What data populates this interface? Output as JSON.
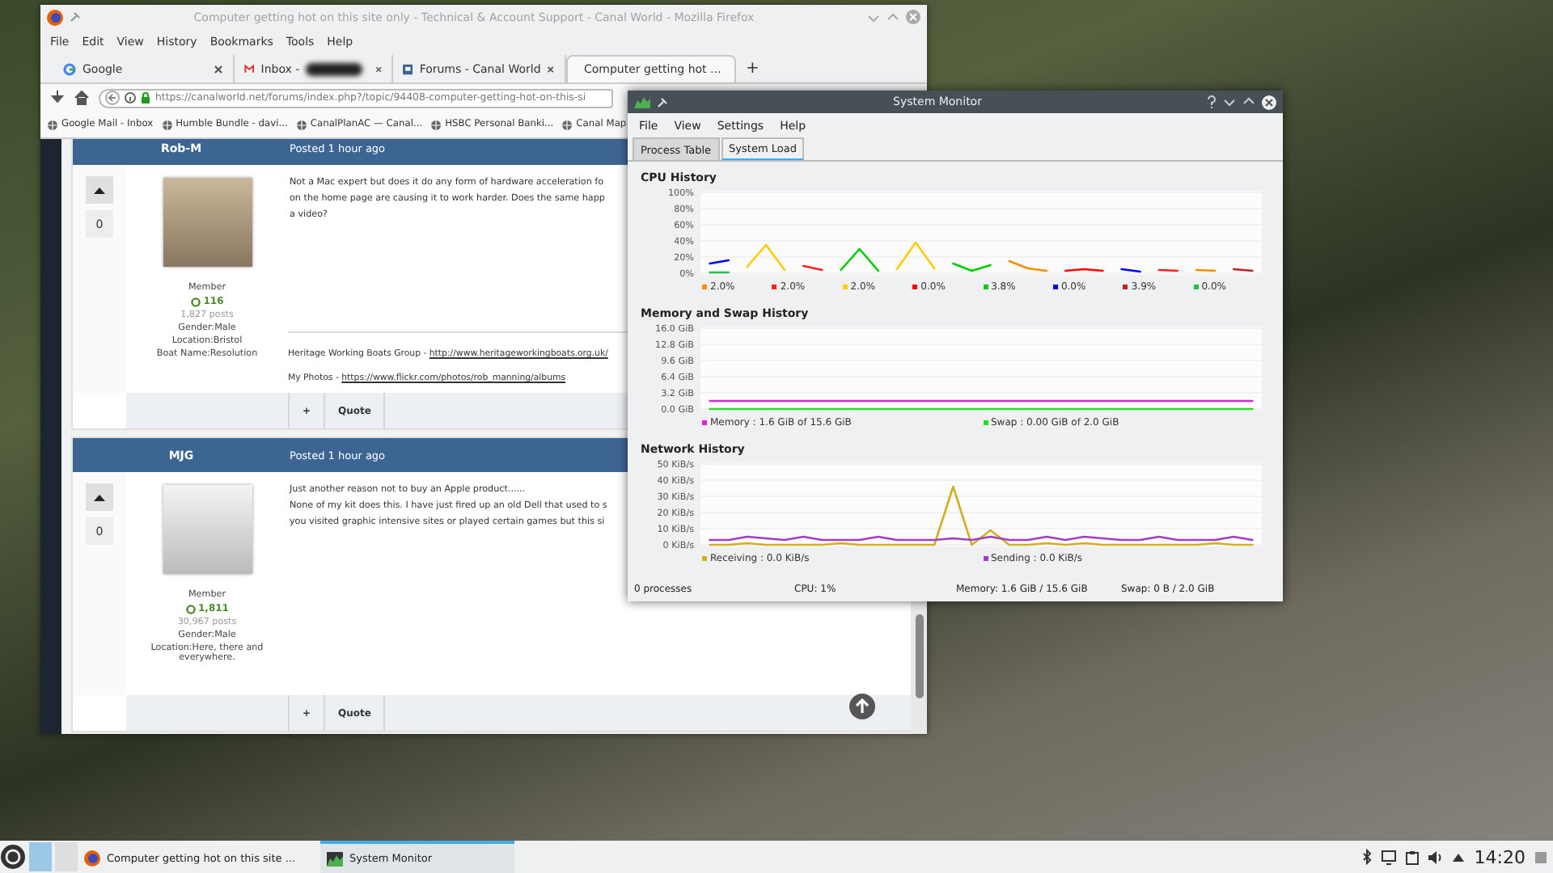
{
  "browser": {
    "title": "Computer getting hot on this site only - Technical & Account Support - Canal World - Mozilla Firefox",
    "menu": [
      "File",
      "Edit",
      "View",
      "History",
      "Bookmarks",
      "Tools",
      "Help"
    ],
    "tabs": [
      {
        "label": "Google",
        "kind": "google",
        "selected": false
      },
      {
        "label": "Inbox -",
        "kind": "mail",
        "selected": false
      },
      {
        "label": "Forums - Canal World",
        "kind": "forum",
        "selected": false
      },
      {
        "label": "Computer getting hot ...",
        "kind": "forum",
        "selected": true
      }
    ],
    "new_tab": "+",
    "url": "https://canalworld.net/forums/index.php?/topic/94408-computer-getting-hot-on-this-si",
    "bookmarks": [
      "Google Mail - Inbox",
      "Humble Bundle - davi...",
      "CanalPlanAC — Canal...",
      "HSBC Personal Banki...",
      "Canal Map"
    ],
    "posts": [
      {
        "author": "Rob-M",
        "posted": "Posted 1 hour ago",
        "votes": "0",
        "group": "Member",
        "reputation": "116",
        "post_count": "1,827 posts",
        "details": [
          "Gender:Male",
          "Location:Bristol",
          "Boat Name:Resolution"
        ],
        "body": [
          "Not a Mac expert but does it do any form of hardware acceleration fo",
          "on the home page are causing it to work harder. Does the same happ",
          "a video?"
        ],
        "signature": [
          {
            "label": "Heritage Working Boats Group -",
            "link": "http://www.heritageworkingboats.org.uk/"
          },
          {
            "label": "My Photos -",
            "link": "https://www.flickr.com/photos/rob_manning/albums"
          }
        ],
        "actions": [
          "+",
          "Quote"
        ]
      },
      {
        "author": "MJG",
        "posted": "Posted 1 hour ago",
        "votes": "0",
        "group": "Member",
        "reputation": "1,811",
        "post_count": "30,967 posts",
        "details": [
          "Gender:Male",
          "Location:Here, there and everywhere."
        ],
        "body": [
          "Just another reason not to buy an Apple product......",
          "None of my kit does this. I have just fired up an old Dell that used to s",
          "you visited graphic intensive sites or played certain games but this si"
        ],
        "actions": [
          "+",
          "Quote"
        ]
      }
    ]
  },
  "system_monitor": {
    "title": "System Monitor",
    "menu": [
      "File",
      "View",
      "Settings",
      "Help"
    ],
    "tabs": [
      {
        "label": "Process Table",
        "selected": false
      },
      {
        "label": "System Load",
        "selected": true
      }
    ],
    "sections": [
      {
        "title": "CPU History",
        "chart_data": {
          "type": "line",
          "grid": true,
          "legend": "bottom",
          "ylim": [
            0,
            100
          ],
          "yticks": [
            {
              "value": 100,
              "label": "100%"
            },
            {
              "value": 80,
              "label": "80%"
            },
            {
              "value": 60,
              "label": "60%"
            },
            {
              "value": 40,
              "label": "40%"
            },
            {
              "value": 20,
              "label": "20%"
            },
            {
              "value": 0,
              "label": "0%"
            }
          ],
          "series": [
            {
              "name": "2.0%",
              "color": "#ff8c00",
              "values": [
                null,
                null,
                null,
                null,
                null,
                null,
                null,
                null,
                null,
                null,
                null,
                null,
                null,
                null,
                null,
                null,
                15,
                6,
                3,
                null,
                null,
                null,
                null,
                null,
                null,
                null,
                4,
                3,
                null,
                null
              ]
            },
            {
              "name": "2.0%",
              "color": "#ff2020",
              "values": [
                null,
                null,
                null,
                null,
                null,
                9,
                4,
                null,
                null,
                null,
                null,
                null,
                null,
                null,
                null,
                null,
                null,
                null,
                null,
                null,
                null,
                null,
                null,
                null,
                4,
                3,
                null,
                null,
                null,
                null
              ]
            },
            {
              "name": "2.0%",
              "color": "#ffcc00",
              "values": [
                null,
                null,
                8,
                35,
                4,
                null,
                null,
                null,
                null,
                null,
                5,
                38,
                6,
                null,
                null,
                null,
                null,
                null,
                null,
                null,
                null,
                null,
                null,
                null,
                null,
                null,
                null,
                null,
                null,
                null
              ]
            },
            {
              "name": "0.0%",
              "color": "#ff0000",
              "values": [
                null,
                null,
                null,
                null,
                null,
                null,
                null,
                null,
                null,
                null,
                null,
                null,
                null,
                null,
                null,
                null,
                null,
                null,
                null,
                3,
                5,
                3,
                null,
                null,
                null,
                null,
                null,
                null,
                null,
                null
              ]
            },
            {
              "name": "3.8%",
              "color": "#00cc00",
              "values": [
                null,
                null,
                null,
                null,
                null,
                null,
                null,
                4,
                30,
                3,
                null,
                null,
                null,
                12,
                3,
                10,
                null,
                null,
                null,
                null,
                null,
                null,
                null,
                null,
                null,
                null,
                null,
                null,
                null,
                null
              ]
            },
            {
              "name": "0.0%",
              "color": "#0000ff",
              "values": [
                12,
                16,
                null,
                null,
                null,
                null,
                null,
                null,
                null,
                null,
                null,
                null,
                null,
                null,
                null,
                null,
                null,
                null,
                null,
                null,
                null,
                null,
                5,
                2,
                null,
                null,
                null,
                null,
                null,
                null
              ]
            },
            {
              "name": "3.9%",
              "color": "#c02020",
              "values": [
                null,
                null,
                null,
                null,
                null,
                null,
                null,
                null,
                null,
                null,
                null,
                null,
                null,
                null,
                null,
                null,
                null,
                null,
                null,
                null,
                null,
                null,
                null,
                null,
                null,
                null,
                null,
                null,
                5,
                3
              ]
            },
            {
              "name": "0.0%",
              "color": "#20c040",
              "values": [
                1,
                1,
                null,
                null,
                null,
                null,
                null,
                null,
                null,
                null,
                null,
                null,
                null,
                null,
                null,
                null,
                null,
                null,
                null,
                null,
                null,
                null,
                null,
                null,
                null,
                null,
                null,
                null,
                null,
                null
              ]
            }
          ]
        }
      },
      {
        "title": "Memory and Swap History",
        "chart_data": {
          "type": "line",
          "grid": true,
          "legend": "bottom",
          "ylim": [
            0,
            16
          ],
          "yticks": [
            {
              "value": 16,
              "label": "16.0 GiB"
            },
            {
              "value": 12.8,
              "label": "12.8 GiB"
            },
            {
              "value": 9.6,
              "label": "9.6 GiB"
            },
            {
              "value": 6.4,
              "label": "6.4 GiB"
            },
            {
              "value": 3.2,
              "label": "3.2 GiB"
            },
            {
              "value": 0,
              "label": "0.0 GiB"
            }
          ],
          "series": [
            {
              "name": "Memory : 1.6 GiB of 15.6 GiB",
              "color": "#e020e0",
              "values": [
                1.6,
                1.6,
                1.6,
                1.6,
                1.6,
                1.6,
                1.6,
                1.6,
                1.6,
                1.6,
                1.6,
                1.6,
                1.6,
                1.6,
                1.6,
                1.6,
                1.6,
                1.6,
                1.6,
                1.6,
                1.6,
                1.6,
                1.6,
                1.6,
                1.6,
                1.6,
                1.6,
                1.6,
                1.6,
                1.6
              ]
            },
            {
              "name": "Swap : 0.00 GiB of 2.0 GiB",
              "color": "#20e020",
              "values": [
                0,
                0,
                0,
                0,
                0,
                0,
                0,
                0,
                0,
                0,
                0,
                0,
                0,
                0,
                0,
                0,
                0,
                0,
                0,
                0,
                0,
                0,
                0,
                0,
                0,
                0,
                0,
                0,
                0,
                0
              ]
            }
          ]
        }
      },
      {
        "title": "Network History",
        "chart_data": {
          "type": "line",
          "grid": true,
          "legend": "bottom",
          "ylim": [
            0,
            50
          ],
          "yticks": [
            {
              "value": 50,
              "label": "50 KiB/s"
            },
            {
              "value": 40,
              "label": "40 KiB/s"
            },
            {
              "value": 30,
              "label": "30 KiB/s"
            },
            {
              "value": 20,
              "label": "20 KiB/s"
            },
            {
              "value": 10,
              "label": "10 KiB/s"
            },
            {
              "value": 0,
              "label": "0 KiB/s"
            }
          ],
          "series": [
            {
              "name": "Receiving : 0.0 KiB/s",
              "color": "#d0b020",
              "values": [
                0,
                0,
                1,
                0,
                0,
                0,
                0,
                1,
                0,
                0,
                0,
                0,
                0,
                36,
                0,
                9,
                0,
                0,
                1,
                0,
                1,
                0,
                0,
                0,
                0,
                0,
                0,
                1,
                0,
                0
              ]
            },
            {
              "name": "Sending : 0.0 KiB/s",
              "color": "#a040c0",
              "values": [
                3,
                3,
                5,
                4,
                3,
                5,
                3,
                3,
                3,
                5,
                3,
                3,
                3,
                4,
                3,
                5,
                3,
                3,
                5,
                3,
                5,
                4,
                3,
                3,
                5,
                3,
                3,
                3,
                5,
                3
              ]
            }
          ]
        }
      }
    ],
    "status": [
      "0 processes",
      "CPU: 1%",
      "Memory: 1.6 GiB / 15.6 GiB",
      "Swap: 0 B / 2.0 GiB"
    ]
  },
  "taskbar": {
    "tasks": [
      {
        "label": "Computer getting hot on this site ...",
        "kind": "browser",
        "selected": false
      },
      {
        "label": "System Monitor",
        "kind": "monitor",
        "selected": true
      }
    ],
    "clock": "14:20"
  }
}
